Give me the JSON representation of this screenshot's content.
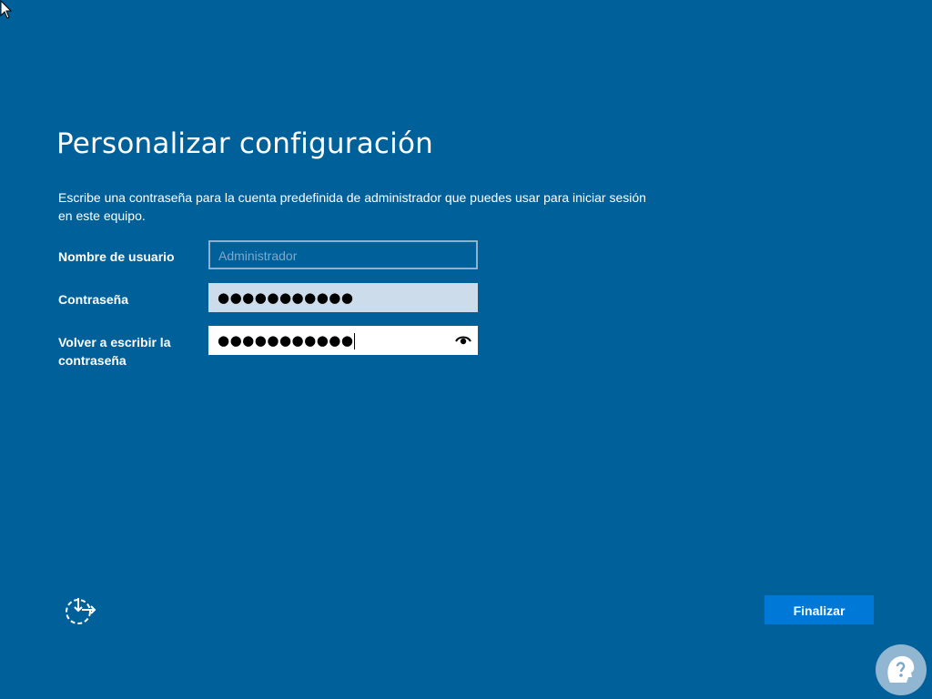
{
  "page": {
    "title": "Personalizar configuración",
    "description": "Escribe una contraseña para la cuenta predefinida de administrador que puedes usar para iniciar sesión en este equipo."
  },
  "form": {
    "username_label": "Nombre de usuario",
    "username_placeholder": "Administrador",
    "password_label": "Contraseña",
    "password_value": "●●●●●●●●●●●",
    "confirm_label": "Volver a escribir la contraseña",
    "confirm_value": "●●●●●●●●●●●"
  },
  "footer": {
    "finish_label": "Finalizar"
  },
  "icons": {
    "cursor": "mouse-pointer-icon",
    "eye": "reveal-password-eye-icon",
    "accessibility": "ease-of-access-icon",
    "watermark": "person-head-logo"
  },
  "colors": {
    "background": "#00609a",
    "button": "#0078d7",
    "password_field": "#cddceb",
    "confirm_field": "#ffffff",
    "placeholder_text": "#7ea9c9"
  }
}
